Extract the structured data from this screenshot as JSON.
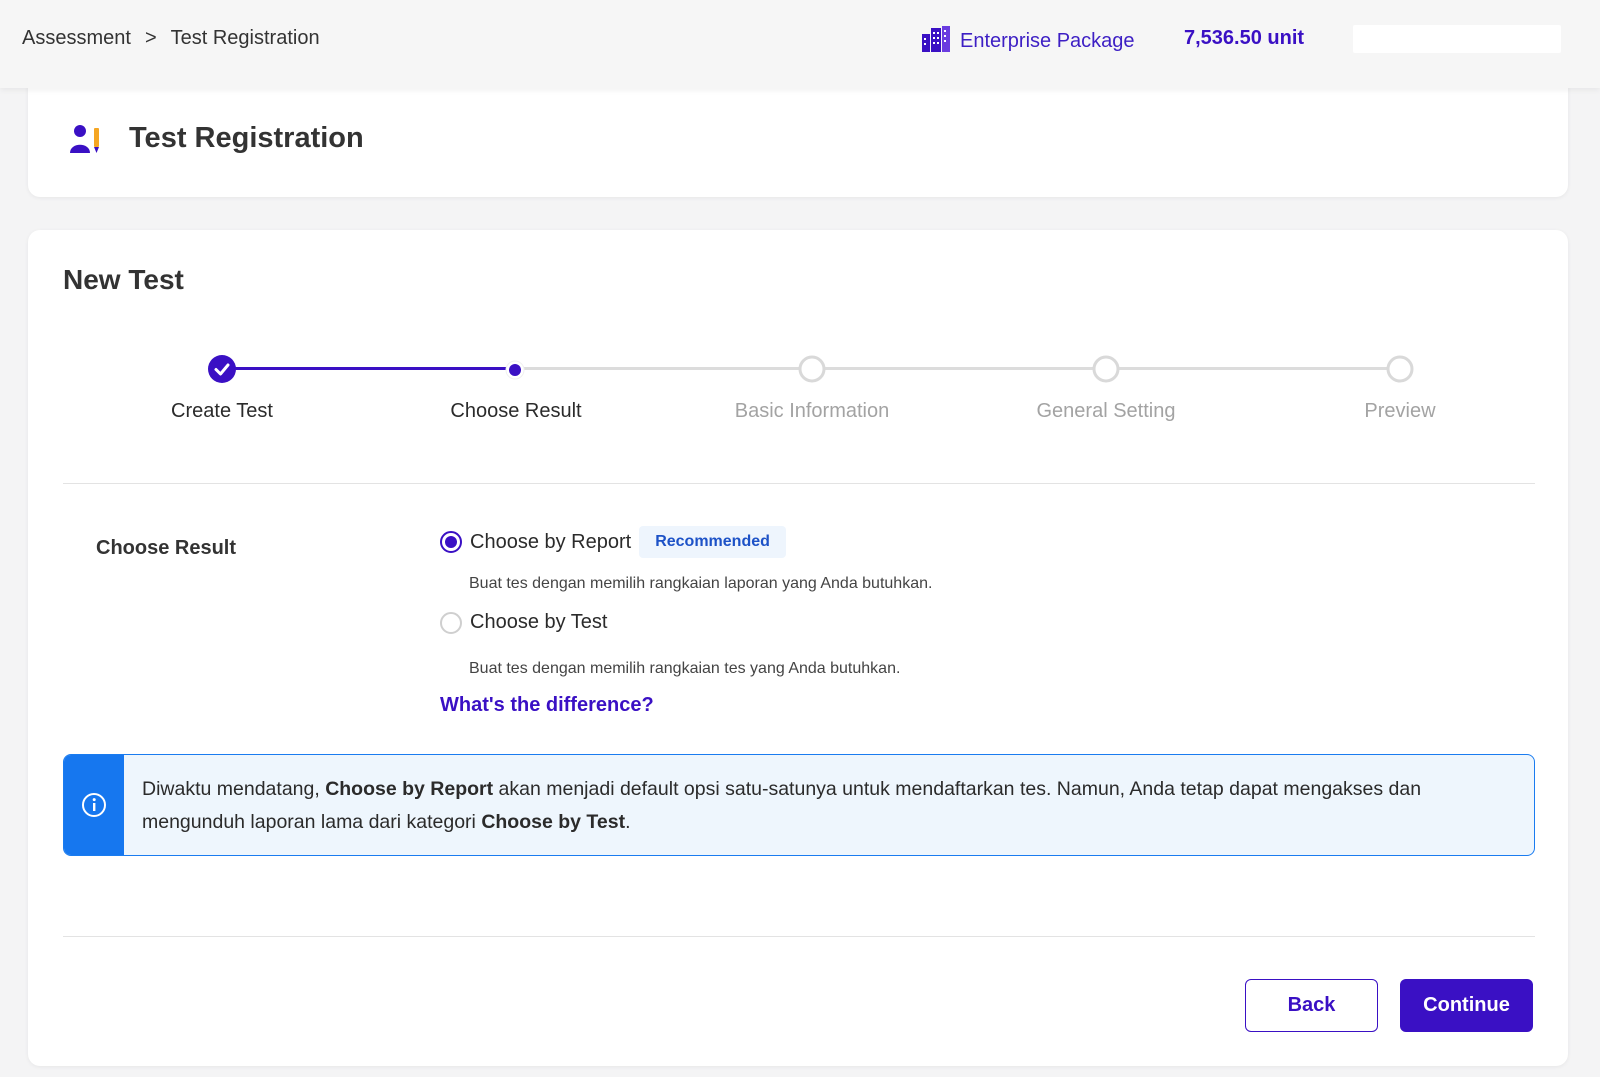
{
  "header": {
    "breadcrumb": [
      "Assessment",
      "Test Registration"
    ],
    "breadcrumb_separator": ">",
    "package_label": "Enterprise Package",
    "balance": "7,536.50 unit"
  },
  "page": {
    "title": "Test Registration"
  },
  "form": {
    "heading": "New Test",
    "steps": [
      {
        "label": "Create Test",
        "status": "completed"
      },
      {
        "label": "Choose Result",
        "status": "current"
      },
      {
        "label": "Basic Information",
        "status": "upcoming"
      },
      {
        "label": "General Setting",
        "status": "upcoming"
      },
      {
        "label": "Preview",
        "status": "upcoming"
      }
    ],
    "section_label": "Choose Result",
    "options": [
      {
        "label": "Choose by Report",
        "badge": "Recommended",
        "description": "Buat tes dengan memilih rangkaian laporan yang Anda butuhkan.",
        "selected": true
      },
      {
        "label": "Choose by Test",
        "description": "Buat tes dengan memilih rangkaian tes yang Anda butuhkan.",
        "selected": false
      }
    ],
    "difference_link": "What's the difference?",
    "info": {
      "part1": "Diwaktu mendatang, ",
      "bold1": "Choose by Report",
      "part2": " akan menjadi default opsi satu-satunya untuk mendaftarkan tes. Namun, Anda tetap dapat mengakses dan mengunduh laporan lama dari kategori ",
      "bold2": "Choose by Test",
      "part3": "."
    },
    "back_label": "Back",
    "continue_label": "Continue"
  },
  "colors": {
    "primary": "#3a10c4",
    "info_accent": "#1677ef",
    "inactive": "#d9d9d9",
    "muted_text": "#9a9a9a"
  }
}
